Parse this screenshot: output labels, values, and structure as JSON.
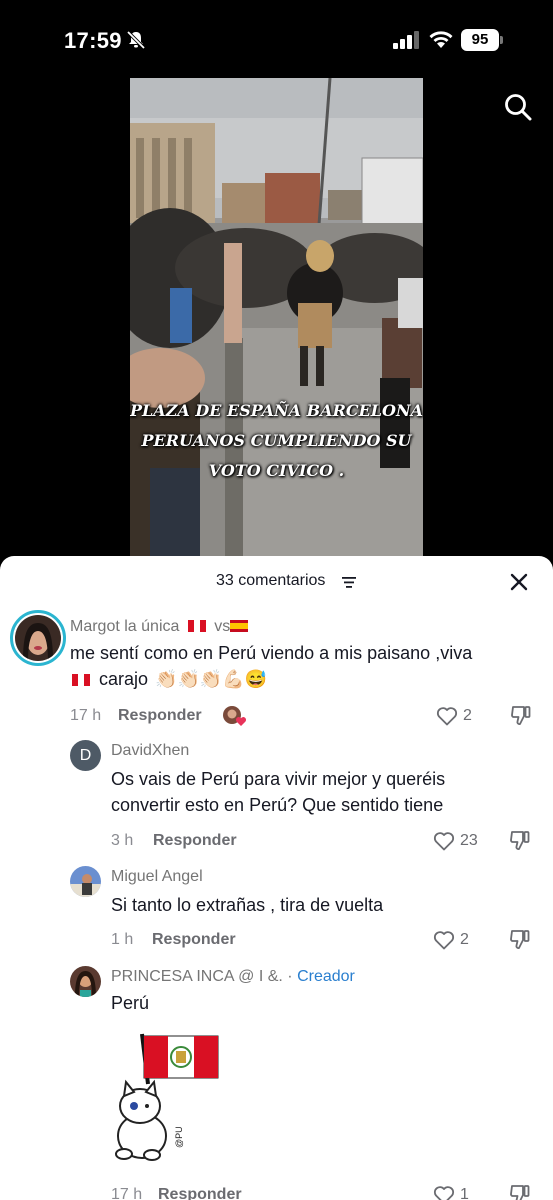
{
  "status_bar": {
    "time": "17:59",
    "battery": "95"
  },
  "video": {
    "caption_lines": [
      "PLAZA DE ESPAÑA BARCELONA",
      "PERUANOS CUMPLIENDO SU",
      "VOTO CIVICO ."
    ]
  },
  "sheet": {
    "comments_count": "33 comentarios"
  },
  "comments": [
    {
      "username": "Margot la única",
      "text_line1": "me sentí como en Perú viendo a mis paisano ,viva",
      "text_line2": "carajo",
      "emojis": "👏🏻👏🏻👏🏻💪🏻😅",
      "time": "17 h",
      "reply_label": "Responder",
      "likes": "2"
    },
    {
      "username": "DavidXhen",
      "avatar_letter": "D",
      "text_line1": "Os vais de Perú para vivir mejor y queréis",
      "text_line2": "convertir esto en Perú? Que sentido tiene",
      "time": "3 h",
      "reply_label": "Responder",
      "likes": "23"
    },
    {
      "username": "Miguel Angel",
      "text_line1": "Si tanto lo extrañas , tira de vuelta",
      "time": "1 h",
      "reply_label": "Responder",
      "likes": "2"
    },
    {
      "username": "PRINCESA INCA @ I &.",
      "separator": "·",
      "creator_label": "Creador",
      "text_line1": "Perú",
      "time": "17 h",
      "reply_label": "Responder",
      "likes": "1"
    }
  ],
  "colors": {
    "accent_link": "#2a7fcf",
    "like_heart": "#e8335a"
  }
}
